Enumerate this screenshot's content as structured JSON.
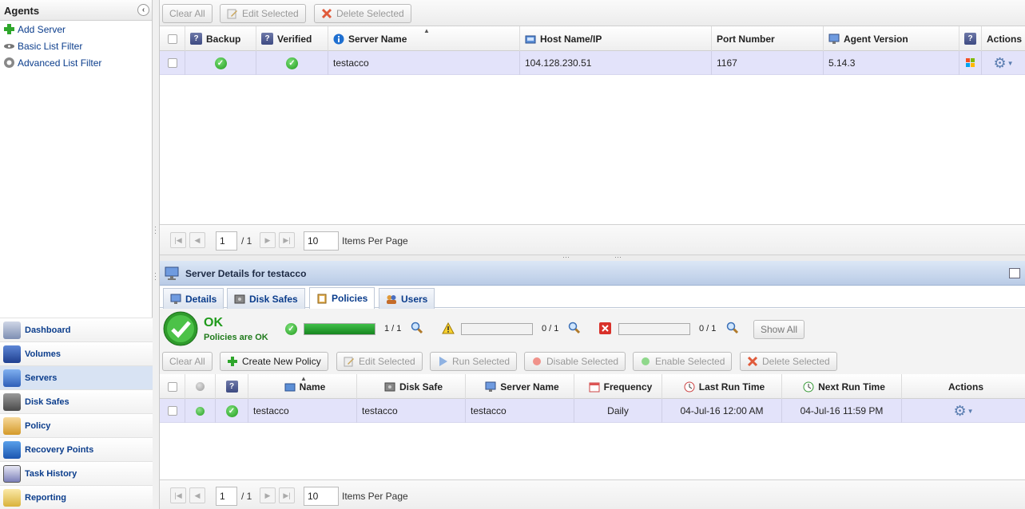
{
  "left": {
    "title": "Agents",
    "agent_links": [
      {
        "label": "Add Server",
        "icon": "add-icon"
      },
      {
        "label": "Basic List Filter",
        "icon": "filter-icon"
      },
      {
        "label": "Advanced List Filter",
        "icon": "advanced-filter-icon"
      }
    ],
    "nav": [
      {
        "label": "Dashboard",
        "icon": "dashboard-icon"
      },
      {
        "label": "Volumes",
        "icon": "volumes-icon"
      },
      {
        "label": "Servers",
        "icon": "servers-icon",
        "active": true
      },
      {
        "label": "Disk Safes",
        "icon": "disk-safes-icon"
      },
      {
        "label": "Policy",
        "icon": "policy-icon"
      },
      {
        "label": "Recovery Points",
        "icon": "recovery-points-icon"
      },
      {
        "label": "Task History",
        "icon": "task-history-icon"
      },
      {
        "label": "Reporting",
        "icon": "reporting-icon"
      }
    ]
  },
  "top": {
    "toolbar": {
      "clear_all": "Clear All",
      "edit_selected": "Edit Selected",
      "delete_selected": "Delete Selected"
    },
    "columns": {
      "backup": "Backup",
      "verified": "Verified",
      "server_name": "Server Name",
      "host_name": "Host Name/IP",
      "port": "Port Number",
      "agent_version": "Agent Version",
      "actions": "Actions"
    },
    "row": {
      "server_name": "testacco",
      "host": "104.128.230.51",
      "port": "1167",
      "version": "5.14.3"
    },
    "pager": {
      "page": "1",
      "of": "/ 1",
      "per_page": "10",
      "per_page_label": "Items Per Page"
    }
  },
  "details": {
    "title": "Server Details for testacco",
    "tabs": [
      "Details",
      "Disk Safes",
      "Policies",
      "Users"
    ],
    "status": {
      "state": "OK",
      "message": "Policies are OK",
      "ok_count": "1 / 1",
      "ok_progress": 1.0,
      "warn_count": "0 / 1",
      "warn_progress": 0.0,
      "error_count": "0 / 1",
      "error_progress": 0.0,
      "show_all": "Show All"
    },
    "toolbar": {
      "clear_all": "Clear All",
      "create": "Create New Policy",
      "edit": "Edit Selected",
      "run": "Run Selected",
      "disable": "Disable Selected",
      "enable": "Enable Selected",
      "delete": "Delete Selected"
    },
    "columns": {
      "name": "Name",
      "disk_safe": "Disk Safe",
      "server_name": "Server Name",
      "frequency": "Frequency",
      "last_run": "Last Run Time",
      "next_run": "Next Run Time",
      "actions": "Actions"
    },
    "row": {
      "name": "testacco",
      "disk_safe": "testacco",
      "server_name": "testacco",
      "frequency": "Daily",
      "last_run": "04-Jul-16 12:00 AM",
      "next_run": "04-Jul-16 11:59 PM"
    },
    "pager": {
      "page": "1",
      "of": "/ 1",
      "per_page": "10",
      "per_page_label": "Items Per Page"
    }
  },
  "colors": {
    "accent": "#0b3d8c",
    "row_highlight": "#e3e3fa",
    "ok": "#1f9a1b",
    "header_bar": "#c8d8ef"
  }
}
